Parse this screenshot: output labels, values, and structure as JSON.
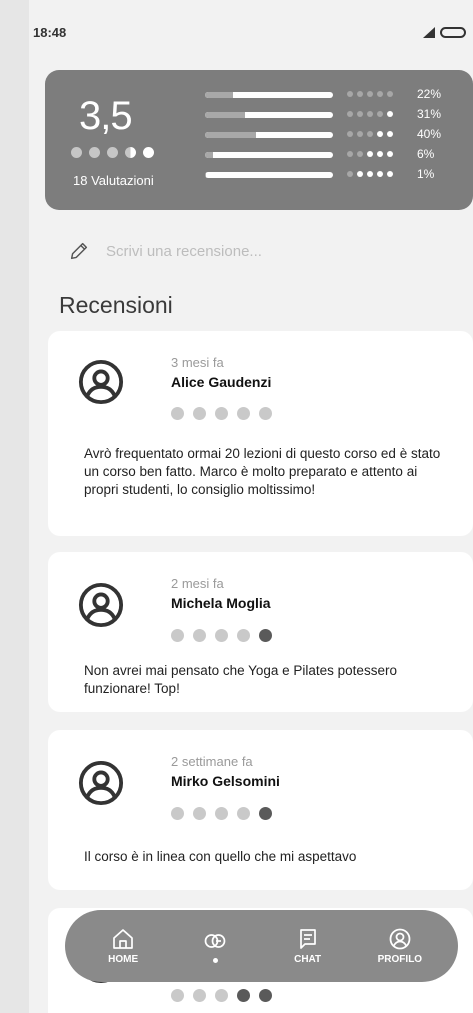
{
  "status_bar": {
    "time": "18:48"
  },
  "rating_summary": {
    "average": "3,5",
    "average_value": 3.5,
    "count_label": "18 Valutazioni",
    "distribution": [
      {
        "stars": 5,
        "percent": "22%",
        "fill": 0.22
      },
      {
        "stars": 4,
        "percent": "31%",
        "fill": 0.31
      },
      {
        "stars": 3,
        "percent": "40%",
        "fill": 0.4
      },
      {
        "stars": 2,
        "percent": "6%",
        "fill": 0.06
      },
      {
        "stars": 1,
        "percent": "1%",
        "fill": 0.01
      }
    ]
  },
  "write_review": {
    "placeholder": "Scrivi una recensione..."
  },
  "reviews_section": {
    "title": "Recensioni",
    "reviews": [
      {
        "date": "3 mesi fa",
        "name": "Alice Gaudenzi",
        "rating": 0,
        "text": "Avrò frequentato ormai 20 lezioni di questo corso ed è stato un corso ben fatto. Marco è molto preparato e attento ai propri studenti, lo consiglio moltissimo!"
      },
      {
        "date": "2 mesi fa",
        "name": "Michela Moglia",
        "rating": 1,
        "text": "Non avrei mai pensato che Yoga e Pilates potessero funzionare! Top!"
      },
      {
        "date": "2 settimane fa",
        "name": "Mirko Gelsomini",
        "rating": 1,
        "text": "Il corso è in linea con quello che mi aspettavo"
      },
      {
        "rating": 2
      }
    ]
  },
  "nav": {
    "items": [
      {
        "label": "HOME",
        "icon": "home-icon"
      },
      {
        "label": "",
        "icon": "courses-icon",
        "active": true
      },
      {
        "label": "CHAT",
        "icon": "chat-icon"
      },
      {
        "label": "PROFILO",
        "icon": "profile-icon"
      }
    ]
  },
  "colors": {
    "card": "#7d7d7d",
    "navbar": "#8a8a8a",
    "background": "#f2f2f2"
  }
}
